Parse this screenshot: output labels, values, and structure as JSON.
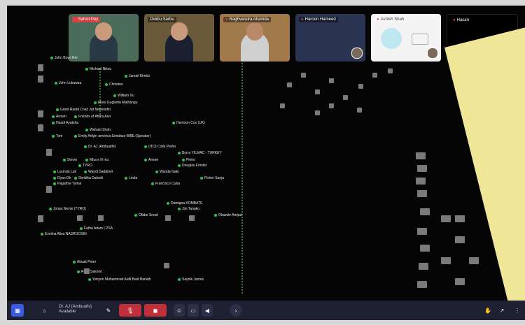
{
  "participants_top": [
    {
      "name": "Sahsil Dey",
      "bg": "#4a6a5a",
      "shirt": "#2a3a45"
    },
    {
      "name": "Ovidiu Sarbu",
      "bg": "#6a5a3a",
      "shirt": "#1a2030"
    },
    {
      "name": "Raghvendra Ahamda",
      "bg": "#a07a4a",
      "shirt": "#cfcfcf"
    },
    {
      "name": "Haroon Hameed",
      "bg": "#2a3450",
      "shirt": ""
    },
    {
      "name": "Ashish Shah",
      "bg": "#f4f4f4",
      "shirt": ""
    },
    {
      "name": "Hasan",
      "bg": "#000000",
      "shirt": ""
    }
  ],
  "canvas_names": [
    "John Boyo Rei",
    "Michael Niksu",
    "Jamail Kimbo",
    "John Lukawaa",
    "Christine",
    "William Xu",
    "Maru Guglietta Mathangu",
    "Grant Radid Chaz Jat Nemesdin",
    "Arman",
    "Friends of Africa Ann",
    "Haadi Ayatsha",
    "Harrison Cox (UK)",
    "Wahabi Shah",
    "Tom",
    "Emily Anlyin america Semibus-WBE (Speaker)",
    "Dr. AJ (Ambuathi)",
    "(ITO) Colla Pedro",
    "Borre YILMAC - TURKEY",
    "Simon",
    "Mba e N mu",
    "Ansee",
    "Pietro",
    "TYRO",
    "Douglas Forster",
    "Lucinda Luk",
    "Wandi Saddmet",
    "Wanda Gato",
    "Dyan Dh",
    "Simbika Dabodi",
    "Linda",
    "Fisher Sanja",
    "Pagattve Tymul",
    "Francisco Cuba",
    "Damigoa KOMBATE",
    "Jiin Tanako",
    "Jonas Nevisi (TYRO)",
    "Ofabe Snoal",
    "Oluwole Amjad",
    "Fatha Adam | PSA",
    "Evelina Alisa NASROOSIN",
    "Akuak Peter",
    "Rosa Sakoon",
    "Yahyon Muhammad Aafil Badi Barakh",
    "Saynik James"
  ],
  "user": {
    "name": "Dr. AJ (Ambuathi)",
    "status": "Available"
  },
  "colors": {
    "sticky": "#f0e697",
    "toolbar": "#1d2030",
    "accent": "#3a5ae0",
    "danger": "#c0303a"
  },
  "icons": [
    "grid-icon",
    "mic-off-icon",
    "camera-off-icon",
    "emoji-icon",
    "screen-share-icon",
    "speaker-icon",
    "chevron-right-icon",
    "hand-icon",
    "cursor-icon",
    "more-icon"
  ]
}
